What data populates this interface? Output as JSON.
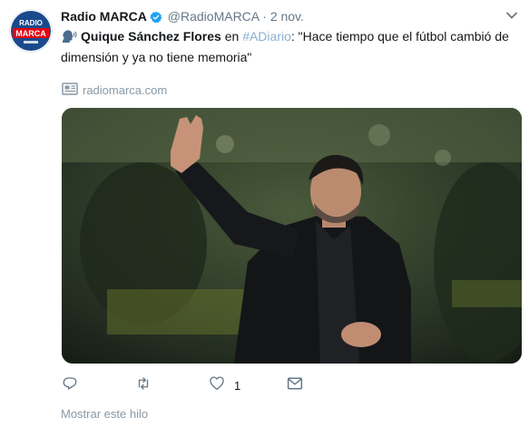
{
  "tweet": {
    "author_name": "Radio MARCA",
    "handle": "@RadioMARCA",
    "separator": "·",
    "time": "2 nov.",
    "avatar": {
      "line1": "RADIO",
      "line2": "MARCA",
      "bg": "#ffffff",
      "circle": "#1b4a8c",
      "band": "#e30613"
    },
    "text": {
      "emoji": "speaking-head-icon",
      "mention": "Quique Sánchez Flores",
      "connector": " en ",
      "hashtag": "#ADiario",
      "quote": ": \"Hace tiempo que el fútbol cambió de dimensión y ya no tiene memoria\""
    },
    "link": {
      "icon": "newspaper-icon",
      "domain": "radiomarca.com"
    },
    "actions": {
      "reply_icon": "reply-icon",
      "retweet_icon": "retweet-icon",
      "like_icon": "heart-icon",
      "like_count": "1",
      "dm_icon": "mail-icon"
    },
    "show_thread": "Mostrar este hilo"
  },
  "colors": {
    "text": "#14171a",
    "secondary": "#657786",
    "hashtag": "#8ab0cf",
    "verified": "#1da1f2"
  }
}
